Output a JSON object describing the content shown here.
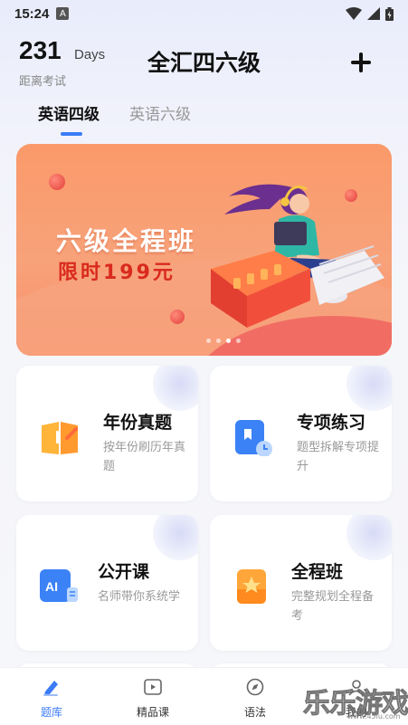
{
  "status_bar": {
    "time": "15:24",
    "a_badge": "A"
  },
  "header": {
    "days_count": "231",
    "days_unit": "Days",
    "days_caption": "距离考试",
    "title": "全汇四六级"
  },
  "tabs": [
    {
      "label": "英语四级",
      "active": true
    },
    {
      "label": "英语六级",
      "active": false
    }
  ],
  "banner": {
    "title": "六级全程班",
    "subtitle": "限时199元",
    "page_count": 4,
    "current_page": 3
  },
  "cards": [
    {
      "title": "年份真题",
      "desc": "按年份刷历年真题",
      "icon": "book-icon"
    },
    {
      "title": "专项练习",
      "desc": "题型拆解专项提升",
      "icon": "bookmark-clock-icon"
    },
    {
      "title": "公开课",
      "desc": "名师带你系统学",
      "icon": "ai-icon"
    },
    {
      "title": "全程班",
      "desc": "完整规划全程备考",
      "icon": "star-box-icon"
    }
  ],
  "bottom_nav": [
    {
      "label": "题库",
      "icon": "pen-icon",
      "active": true
    },
    {
      "label": "精品课",
      "icon": "play-icon",
      "active": false
    },
    {
      "label": "语法",
      "icon": "compass-icon",
      "active": false
    },
    {
      "label": "我的",
      "icon": "user-icon",
      "active": false
    }
  ],
  "watermark": {
    "text": "乐乐游戏",
    "url": "www.45lu.com"
  },
  "colors": {
    "accent": "#3b7cf6",
    "banner": "#fa9a6a",
    "banner_price": "#d92a1d"
  }
}
